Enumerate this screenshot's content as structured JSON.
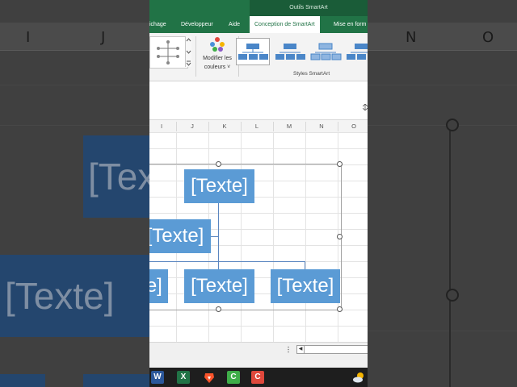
{
  "window": {
    "context_title": "Outils SmartArt"
  },
  "tabs": [
    {
      "label": "ichage",
      "active": false
    },
    {
      "label": "Développeur",
      "active": false
    },
    {
      "label": "Aide",
      "active": false
    },
    {
      "label": "Conception de SmartArt",
      "active": true
    },
    {
      "label": "Mise en form",
      "active": false
    }
  ],
  "ribbon": {
    "change_colors_line1": "Modifier les",
    "change_colors_line2": "couleurs ˅",
    "styles_group_label": "Styles SmartArt",
    "style_count_visible": 4
  },
  "columns": [
    "I",
    "J",
    "K",
    "L",
    "M",
    "N",
    "O"
  ],
  "smartart": {
    "placeholder": "[Texte]",
    "node_color": "#5b9bd5"
  },
  "background": {
    "columns": [
      "I",
      "J",
      "N",
      "O"
    ],
    "placeholder": "[Texte]"
  },
  "taskbar": {
    "apps": [
      "word-icon",
      "excel-icon",
      "brave-icon",
      "camtasia-green-icon",
      "camtasia-orange-icon",
      "weather-icon"
    ]
  },
  "colors": {
    "excel_green": "#217346",
    "smartart_blue": "#5b9bd5"
  }
}
